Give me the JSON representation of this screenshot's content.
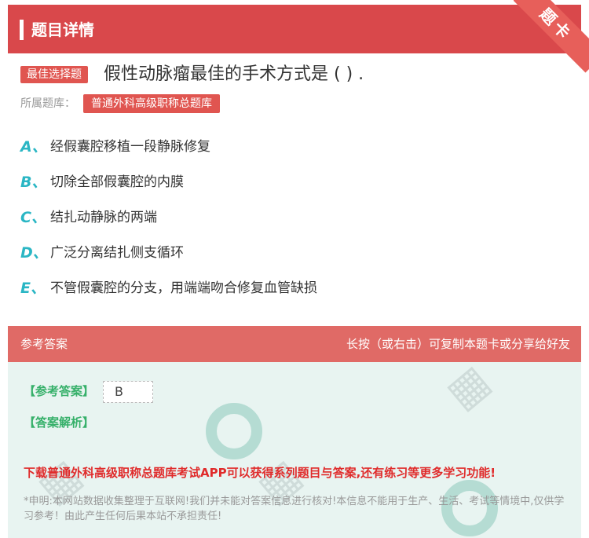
{
  "header": {
    "title": "题目详情",
    "ribbon": "题卡"
  },
  "question": {
    "tag": "最佳选择题",
    "text": "假性动脉瘤最佳的手术方式是 ( ) ."
  },
  "bank": {
    "label": "所属题库：",
    "name": "普通外科高级职称总题库"
  },
  "options": [
    {
      "letter": "A、",
      "text": "经假囊腔移植一段静脉修复"
    },
    {
      "letter": "B、",
      "text": "切除全部假囊腔的内膜"
    },
    {
      "letter": "C、",
      "text": "结扎动静脉的两端"
    },
    {
      "letter": "D、",
      "text": "广泛分离结扎侧支循环"
    },
    {
      "letter": "E、",
      "text": "不管假囊腔的分支，用端端吻合修复血管缺损"
    }
  ],
  "answer_header": {
    "left": "参考答案",
    "right": "长按（或右击）可复制本题卡或分享给好友"
  },
  "answer": {
    "label": "【参考答案】",
    "value": "B",
    "analysis_label": "【答案解析】"
  },
  "promo": "下载普通外科高级职称总题库考试APP可以获得系列题目与答案,还有练习等更多学习功能!",
  "disclaimer": "*申明:本网站数据收集整理于互联网!我们并未能对答案信息进行核对!本信息不能用于生产、生活、考试等情境中,仅供学习参考！由此产生任何后果本站不承担责任!",
  "colors": {
    "header": "#d9484b",
    "accent": "#2ab6c4",
    "answer_green": "#36b06a",
    "promo_red": "#e02b2b"
  }
}
